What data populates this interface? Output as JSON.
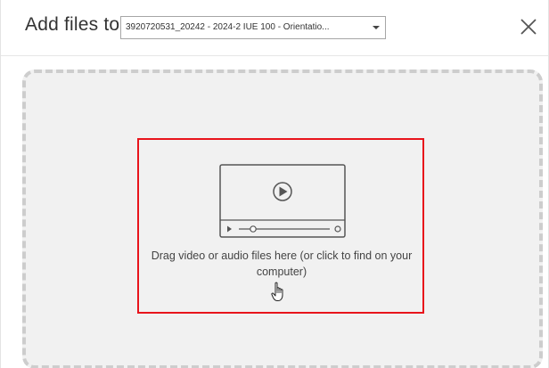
{
  "header": {
    "title": "Add files to",
    "folder_value": "3920720531_20242 - 2024-2 IUE 100 - Orientatio..."
  },
  "dropzone": {
    "text": "Drag video or audio files here (or click to find on your computer)"
  },
  "icons": {
    "close": "close-icon",
    "video": "video-player-icon",
    "dropdown": "chevron-down-icon",
    "cursor": "hand-pointer-icon"
  },
  "colors": {
    "highlight": "#e8141b",
    "dropzone_bg": "#f1f1f1",
    "dashed_border": "#cdcdcd"
  }
}
